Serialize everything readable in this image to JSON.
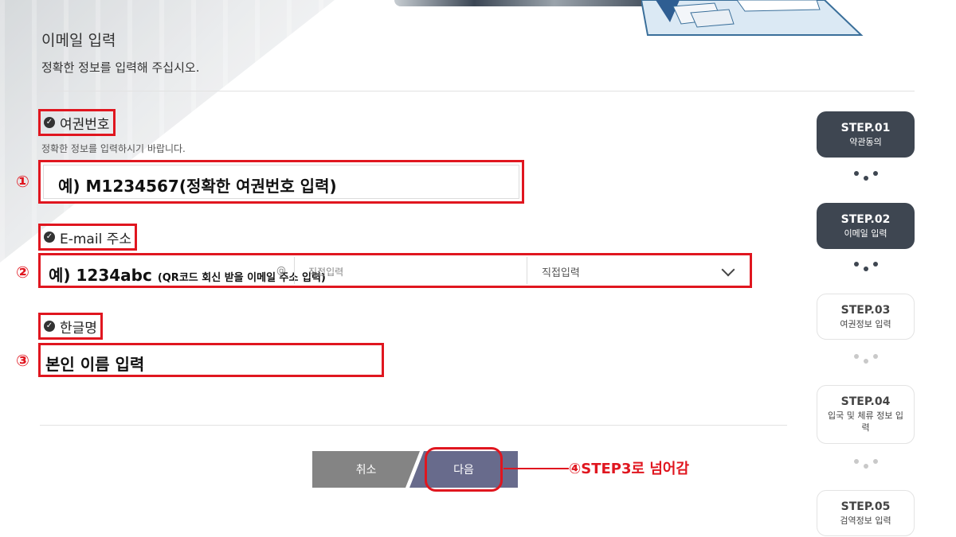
{
  "header": {
    "title": "이메일 입력",
    "subtitle": "정확한 정보를 입력해 주십시오."
  },
  "passport": {
    "label": "여권번호",
    "hint": "정확한 정보를 입력하시기 바랍니다.",
    "number": "①",
    "placeholder": "예) M1234567(정확한 여권번호 입력)"
  },
  "email": {
    "label": "E-mail 주소",
    "number": "②",
    "placeholder_main": "예) 1234abc",
    "placeholder_note": "(QR코드 회신 받을 이메일 주소 입력)",
    "at_symbol": "@",
    "domain_placeholder": "직접입력",
    "domain_select": "직접입력"
  },
  "korean_name": {
    "label": "한글명",
    "number": "③",
    "placeholder": "본인 이름 입력"
  },
  "buttons": {
    "cancel": "취소",
    "next": "다음"
  },
  "annotation": {
    "next_note": "④STEP3로 넘어감"
  },
  "steps": [
    {
      "num": "STEP.01",
      "name": "약관동의",
      "state": "active"
    },
    {
      "num": "STEP.02",
      "name": "이메일 입력",
      "state": "active"
    },
    {
      "num": "STEP.03",
      "name": "여권정보 입력",
      "state": "inactive"
    },
    {
      "num": "STEP.04",
      "name": "입국 및 체류 정보 입력",
      "state": "inactive"
    },
    {
      "num": "STEP.05",
      "name": "검역정보 입력",
      "state": "inactive"
    }
  ],
  "colors": {
    "highlight": "#e0161f",
    "step_active": "#3e4651",
    "next_button": "#686b8c",
    "cancel_button": "#848484"
  }
}
